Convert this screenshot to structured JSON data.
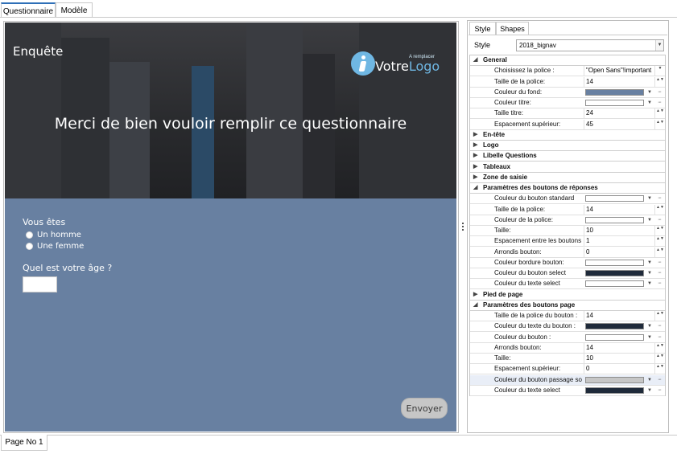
{
  "top_tabs": [
    {
      "label": "Questionnaire",
      "active": true
    },
    {
      "label": "Modèle",
      "active": false
    }
  ],
  "survey": {
    "brand": "Enquête",
    "title": "Merci de bien vouloir remplir ce questionnaire",
    "logo": {
      "subtitle": "A remplacer",
      "word_a": "Votre",
      "word_b": "Logo",
      "mark_color": "#6fb7e3"
    },
    "question1": "Vous êtes",
    "options": [
      "Un homme",
      "Une femme"
    ],
    "question2": "Quel est votre âge ?",
    "age_value": "",
    "submit_label": "Envoyer",
    "body_color": "#6880a1"
  },
  "panel": {
    "tabs": [
      {
        "label": "Style",
        "active": true
      },
      {
        "label": "Shapes",
        "active": false
      }
    ],
    "style_label": "Style",
    "style_value": "2018_bignav",
    "rows": [
      {
        "type": "cat",
        "label": "General",
        "expanded": true
      },
      {
        "type": "prop",
        "label": "Choisissez la police :",
        "value": "\"Open Sans\"!important",
        "editor": "dropdown"
      },
      {
        "type": "prop",
        "label": "Taille de la police:",
        "value": "14",
        "editor": "spin"
      },
      {
        "type": "prop",
        "label": "Couleur du fond:",
        "color": "#6880a1",
        "editor": "color"
      },
      {
        "type": "prop",
        "label": "Couleur titre:",
        "color": "#ffffff",
        "editor": "color"
      },
      {
        "type": "prop",
        "label": "Taille titre:",
        "value": "24",
        "editor": "spin"
      },
      {
        "type": "prop",
        "label": "Espacement supérieur:",
        "value": "45",
        "editor": "spin"
      },
      {
        "type": "cat",
        "label": "En-tête",
        "expanded": false
      },
      {
        "type": "cat",
        "label": "Logo",
        "expanded": false
      },
      {
        "type": "cat",
        "label": "Libelle Questions",
        "expanded": false
      },
      {
        "type": "cat",
        "label": "Tableaux",
        "expanded": false
      },
      {
        "type": "cat",
        "label": "Zone de saisie",
        "expanded": false
      },
      {
        "type": "cat",
        "label": "Paramètres des boutons de réponses",
        "expanded": true
      },
      {
        "type": "prop",
        "label": "Couleur du bouton standard",
        "color": "#ffffff",
        "editor": "color"
      },
      {
        "type": "prop",
        "label": "Taille de la police:",
        "value": "14",
        "editor": "spin"
      },
      {
        "type": "prop",
        "label": "Couleur de la police:",
        "color": "#ffffff",
        "editor": "color"
      },
      {
        "type": "prop",
        "label": "Taille:",
        "value": "10",
        "editor": "spin"
      },
      {
        "type": "prop",
        "label": "Espacement entre les boutons",
        "value": "1",
        "editor": "spin"
      },
      {
        "type": "prop",
        "label": "Arrondis bouton:",
        "value": "0",
        "editor": "spin"
      },
      {
        "type": "prop",
        "label": "Couleur bordure bouton:",
        "color": "#ffffff",
        "editor": "color"
      },
      {
        "type": "prop",
        "label": "Couleur du bouton select",
        "color": "#1f2a3a",
        "editor": "color"
      },
      {
        "type": "prop",
        "label": "Couleur du texte select",
        "color": "#ffffff",
        "editor": "color"
      },
      {
        "type": "cat",
        "label": "Pied de page",
        "expanded": false
      },
      {
        "type": "cat",
        "label": "Paramètres des boutons page",
        "expanded": true
      },
      {
        "type": "prop",
        "label": "Taille de la police du bouton :",
        "value": "14",
        "editor": "spin"
      },
      {
        "type": "prop",
        "label": "Couleur du texte du bouton :",
        "color": "#1f2a3a",
        "editor": "color"
      },
      {
        "type": "prop",
        "label": "Couleur du bouton :",
        "color": "#ffffff",
        "editor": "color"
      },
      {
        "type": "prop",
        "label": "Arrondis bouton:",
        "value": "14",
        "editor": "spin"
      },
      {
        "type": "prop",
        "label": "Taille:",
        "value": "10",
        "editor": "spin"
      },
      {
        "type": "prop",
        "label": "Espacement supérieur:",
        "value": "0",
        "editor": "spin"
      },
      {
        "type": "prop",
        "label": "Couleur du bouton passage so",
        "color": "#c6c6c6",
        "editor": "color",
        "highlight": true
      },
      {
        "type": "prop",
        "label": "Couleur du texte select",
        "color": "#1f2a3a",
        "editor": "color"
      }
    ]
  },
  "bottom_tab": "Page No 1"
}
